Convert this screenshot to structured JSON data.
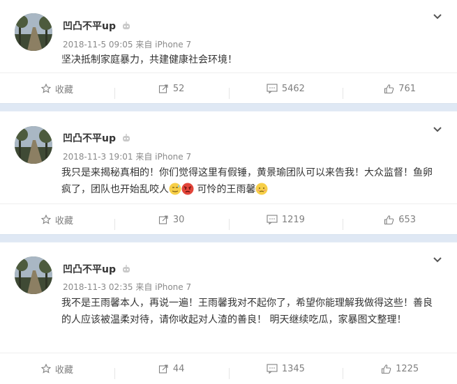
{
  "posts": [
    {
      "username": "凹凸不平up",
      "time": "2018-11-5 09:05",
      "source": "来自 iPhone 7",
      "text": "坚决抵制家庭暴力，共建健康社会环境！",
      "favorite_label": "收藏",
      "repost_count": "52",
      "comment_count": "5462",
      "like_count": "761"
    },
    {
      "username": "凹凸不平up",
      "time": "2018-11-3 19:01",
      "source": "来自 iPhone 7",
      "text_a": "我只是来揭秘真相的！你们觉得这里有假锤，黄景瑜团队可以来告我！大众监督！鱼卵疯了，团队也开始乱咬人",
      "text_b": "可怜的王雨馨",
      "favorite_label": "收藏",
      "repost_count": "30",
      "comment_count": "1219",
      "like_count": "653"
    },
    {
      "username": "凹凸不平up",
      "time": "2018-11-3 02:35",
      "source": "来自 iPhone 7",
      "text": "我不是王雨馨本人，再说一遍！王雨馨我对不起你了，希望你能理解我做得这些！善良的人应该被温柔对待，请你收起对人渣的善良！ 明天继续吃瓜，家暴图文整理！",
      "favorite_label": "收藏",
      "repost_count": "44",
      "comment_count": "1345",
      "like_count": "1225"
    }
  ]
}
